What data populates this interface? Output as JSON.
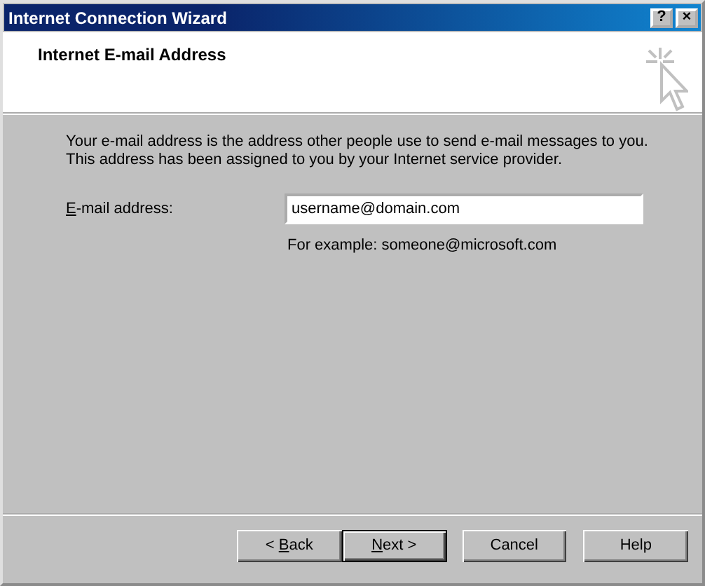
{
  "window": {
    "title": "Internet Connection Wizard",
    "title_buttons": [
      "?",
      "×"
    ]
  },
  "header": {
    "title": "Internet E-mail Address"
  },
  "intro": [
    "Your e-mail address is the address other people use to send e-mail messages to you.",
    "This address has been assigned to you by your Internet service provider."
  ],
  "email": {
    "label": {
      "key": "E",
      "rest": "-mail address:"
    },
    "value": "username@domain.com",
    "hint": "For example: someone@microsoft.com"
  },
  "buttons": [
    {
      "prefix": "< ",
      "key": "B",
      "rest": "ack",
      "default": false
    },
    {
      "key": "N",
      "rest": "ext >",
      "default": true
    },
    {
      "rest": "Cancel",
      "default": false
    },
    {
      "rest": "Help",
      "default": false
    }
  ]
}
